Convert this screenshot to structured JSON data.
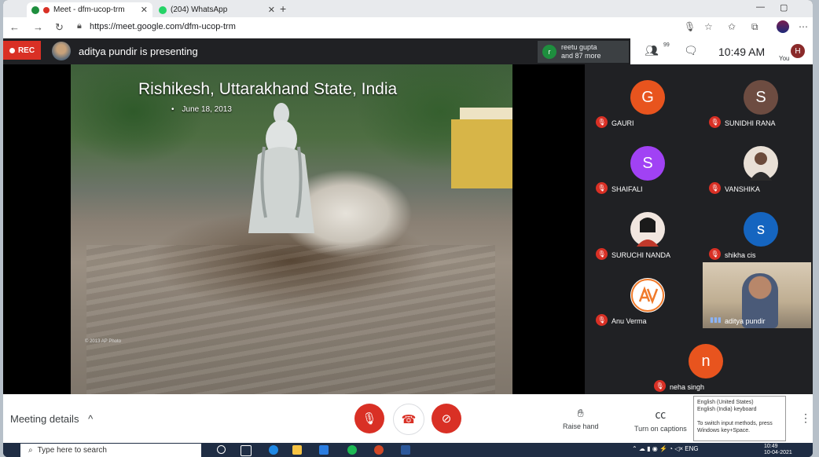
{
  "browser": {
    "tabs": [
      {
        "label": "Meet - dfm-ucop-trm",
        "active": true
      },
      {
        "label": "(204) WhatsApp",
        "active": false
      }
    ],
    "url": "https://meet.google.com/dfm-ucop-trm"
  },
  "meet": {
    "rec_label": "REC",
    "presenting": "aditya pundir is presenting",
    "participants_preview": {
      "initial": "r",
      "line1": "reetu gupta",
      "line2": "and 87 more"
    },
    "participant_count": "99",
    "time": "10:49 AM",
    "you_label": "You",
    "user_initial": "H"
  },
  "slide": {
    "title": "Rishikesh, Uttarakhand State, India",
    "bullet": "June 18, 2013",
    "watermark": "© 2013 AP Photo"
  },
  "tiles": [
    {
      "initial": "G",
      "name": "GAURI",
      "color": "#e8541e"
    },
    {
      "initial": "S",
      "name": "SUNIDHI RANA",
      "color": "#6d4c41"
    },
    {
      "initial": "S",
      "name": "SHAIFALI",
      "color": "#a142f4"
    },
    {
      "initial": "",
      "name": "VANSHIKA",
      "color": "#e9e0d6"
    },
    {
      "initial": "",
      "name": "SURUCHI NANDA",
      "color": "#f1e6df"
    },
    {
      "initial": "s",
      "name": "shikha cis",
      "color": "#1565c0"
    },
    {
      "initial": "",
      "name": "Anu Verma",
      "color": "#ffffff"
    },
    {
      "initial": "n",
      "name": "neha singh",
      "color": "#e8541e"
    }
  ],
  "presenter_tile": {
    "name": "aditya pundir"
  },
  "bottom": {
    "meeting_details": "Meeting details",
    "raise_hand": "Raise hand",
    "captions": "Turn on captions"
  },
  "tooltip": {
    "line1": "English (United States)",
    "line2": "English (India) keyboard",
    "line3": "To switch input methods, press",
    "line4": "Windows key+Space."
  },
  "taskbar": {
    "search_placeholder": "Type here to search",
    "lang": "ENG",
    "clock_time": "10:49",
    "clock_date": "10-04-2021"
  }
}
